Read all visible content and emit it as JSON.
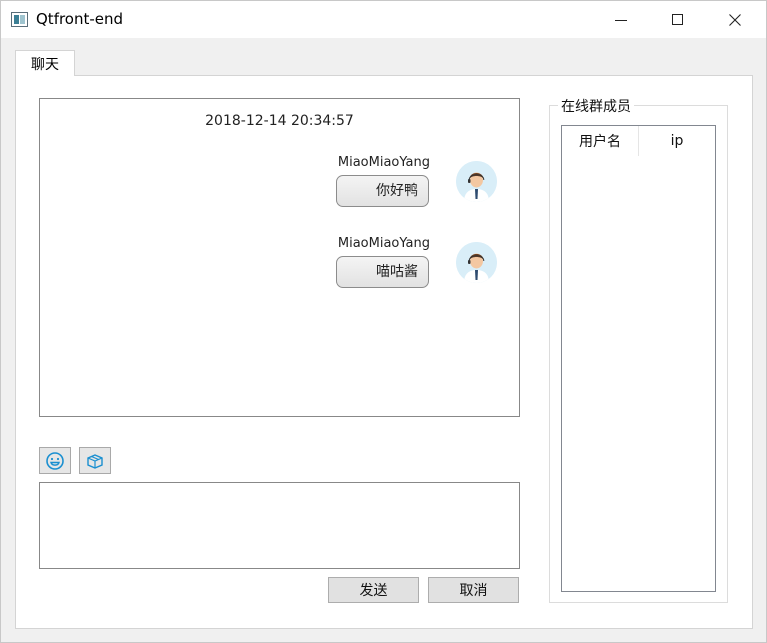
{
  "window": {
    "title": "Qtfront-end"
  },
  "tabs": [
    {
      "label": "聊天"
    }
  ],
  "chat": {
    "timestamp": "2018-12-14 20:34:57",
    "messages": [
      {
        "user": "MiaoMiaoYang",
        "text": "你好鸭"
      },
      {
        "user": "MiaoMiaoYang",
        "text": "喵咕酱"
      }
    ]
  },
  "toolbar": {
    "emoji_icon": "smiley-icon",
    "file_icon": "box-icon"
  },
  "input": {
    "value": ""
  },
  "actions": {
    "send_label": "发送",
    "cancel_label": "取消"
  },
  "members": {
    "title": "在线群成员",
    "columns": [
      "用户名",
      "ip"
    ],
    "rows": []
  },
  "colors": {
    "icon_blue": "#1a8fd0",
    "avatar_bg": "#d9eef8"
  }
}
